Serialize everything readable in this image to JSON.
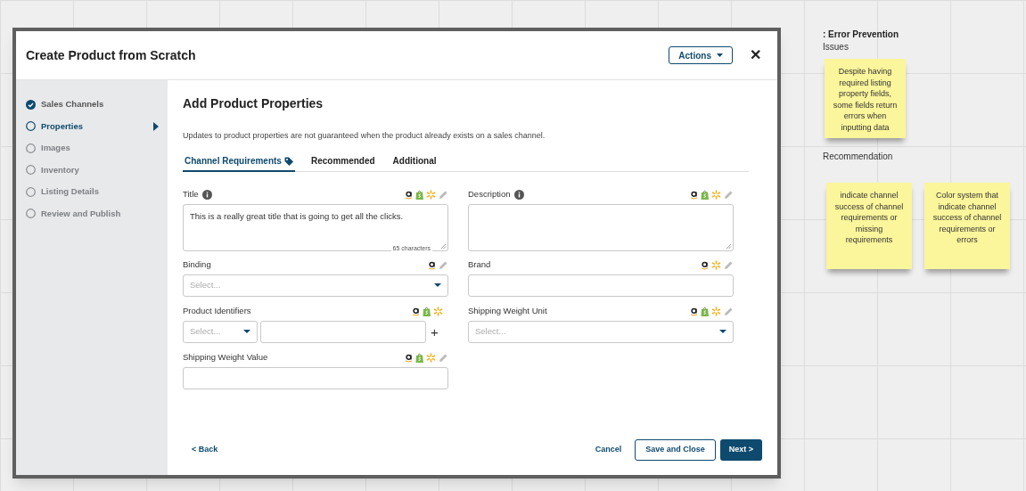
{
  "dialog": {
    "title": "Create Product from Scratch",
    "actions_button": "Actions",
    "close": "✕"
  },
  "steps": [
    {
      "label": "Sales Channels",
      "completed": true,
      "selected": false,
      "disabled": false
    },
    {
      "label": "Properties",
      "completed": false,
      "selected": true,
      "disabled": false
    },
    {
      "label": "Images",
      "completed": false,
      "selected": false,
      "disabled": true
    },
    {
      "label": "Inventory",
      "completed": false,
      "selected": false,
      "disabled": true
    },
    {
      "label": "Listing Details",
      "completed": false,
      "selected": false,
      "disabled": true
    },
    {
      "label": "Review and Publish",
      "completed": false,
      "selected": false,
      "disabled": true
    }
  ],
  "heading": "Add Product Properties",
  "notice": "Updates to product properties are not guaranteed when the product already exists on a sales channel.",
  "tabs": [
    {
      "label": "Channel Requirements",
      "selected": true,
      "tag_icon": true
    },
    {
      "label": "Recommended",
      "selected": false,
      "tag_icon": false
    },
    {
      "label": "Additional",
      "selected": false,
      "tag_icon": false
    }
  ],
  "fields": [
    {
      "kind": "textarea",
      "label": "Title",
      "info": true,
      "icons": [
        {
          "kind": "marketplace"
        },
        {
          "kind": "bag"
        },
        {
          "kind": "spark"
        },
        {
          "kind": "pencil"
        }
      ],
      "value": "This is a really great title that is going to get all the clicks.",
      "counter": "65 characters"
    },
    {
      "kind": "textarea",
      "label": "Description",
      "info": true,
      "icons": [
        {
          "kind": "marketplace"
        },
        {
          "kind": "bag"
        },
        {
          "kind": "spark"
        },
        {
          "kind": "pencil"
        }
      ]
    },
    {
      "kind": "select",
      "label": "Binding",
      "info": false,
      "icons": [
        {
          "kind": "marketplace"
        },
        {
          "kind": "pencil"
        }
      ],
      "placeholder": "Select..."
    },
    {
      "kind": "input",
      "label": "Brand",
      "info": false,
      "icons": [
        {
          "kind": "marketplace"
        },
        {
          "kind": "spark"
        },
        {
          "kind": "pencil"
        }
      ]
    },
    {
      "kind": "identifier",
      "label": "Product Identifiers",
      "info": false,
      "icons": [
        {
          "kind": "marketplace"
        },
        {
          "kind": "bag"
        },
        {
          "kind": "spark"
        }
      ],
      "placeholder": "Select...",
      "add": "+"
    },
    {
      "kind": "select",
      "label": "Shipping Weight Unit",
      "info": false,
      "icons": [
        {
          "kind": "marketplace"
        },
        {
          "kind": "bag"
        },
        {
          "kind": "spark"
        },
        {
          "kind": "pencil"
        }
      ],
      "placeholder": "Select..."
    },
    {
      "kind": "input",
      "label": "Shipping Weight Value",
      "info": false,
      "icons": [
        {
          "kind": "marketplace"
        },
        {
          "kind": "bag"
        },
        {
          "kind": "spark"
        },
        {
          "kind": "pencil"
        }
      ]
    }
  ],
  "footer": {
    "back": "< Back",
    "cancel": "Cancel",
    "save": "Save and Close",
    "next": "Next >"
  },
  "board": {
    "heading": ": Error Prevention",
    "issues_label": "Issues",
    "issues": [
      "Despite having required listing property fields, some fields return errors when inputting data"
    ],
    "recommendation_label": "Recommendation",
    "recommendations": [
      "indicate channel success of channel requirements or missing requirements",
      "Color system that indicate channel success of channel requirements or errors"
    ]
  }
}
